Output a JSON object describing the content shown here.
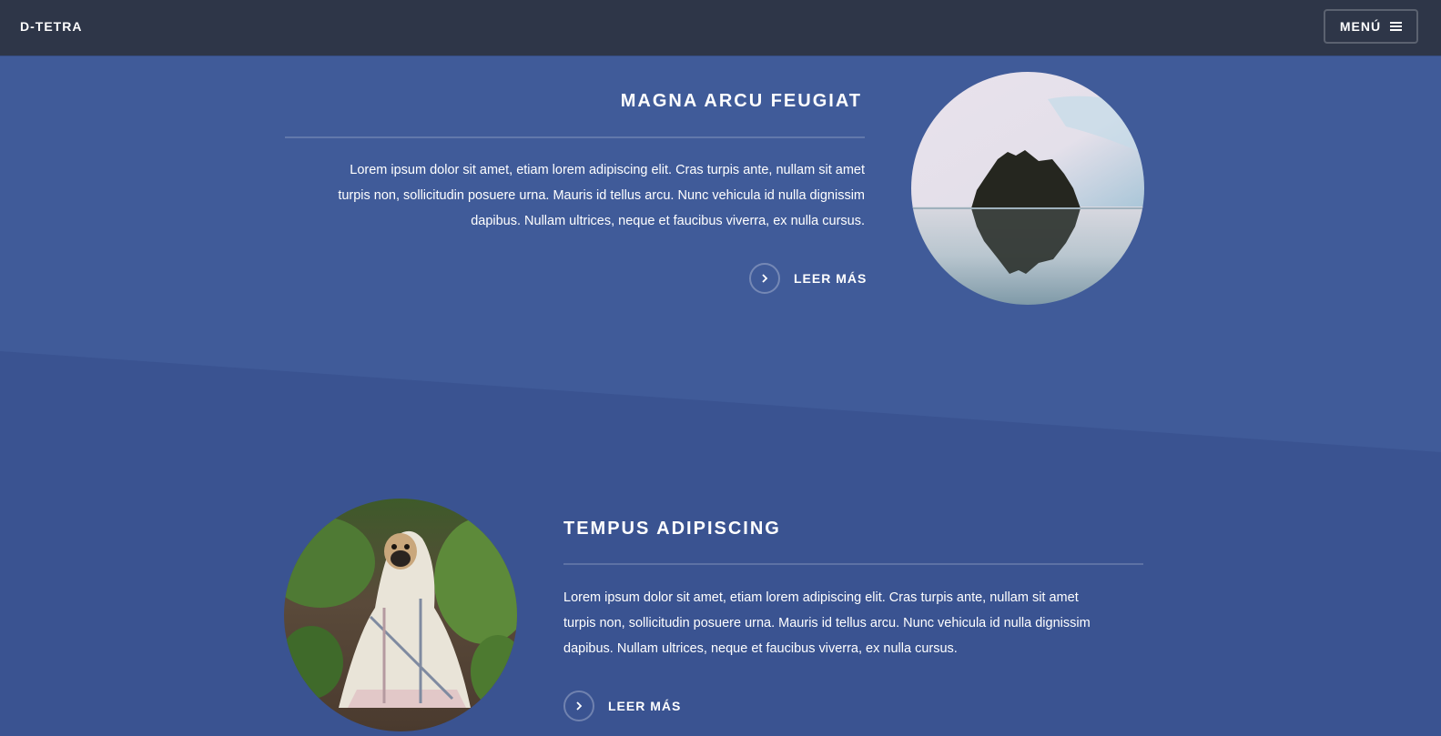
{
  "header": {
    "logo": "D-TETRA",
    "menu_label": "MENÚ",
    "menu_icon": "hamburger-icon"
  },
  "features": [
    {
      "title": "MAGNA ARCU FEUGIAT",
      "text_lines": [
        "Lorem ipsum dolor sit amet, etiam lorem adipiscing elit. Cras turpis ante, nullam sit amet",
        "turpis non, sollicitudin posuere urna. Mauris id tellus arcu. Nunc vehicula id nulla dignissim",
        "dapibus. Nullam ultrices, neque et faucibus viverra, ex nulla cursus."
      ],
      "link_label": "LEER MÁS",
      "link_icon": "chevron-right-icon",
      "image": "rock-island-photo"
    },
    {
      "title": "TEMPUS ADIPISCING",
      "text_lines": [
        "Lorem ipsum dolor sit amet, etiam lorem adipiscing elit. Cras turpis ante, nullam sit amet",
        "turpis non, sollicitudin posuere urna. Mauris id tellus arcu. Nunc vehicula id nulla dignissim",
        "dapibus. Nullam ultrices, neque et faucibus viverra, ex nulla cursus."
      ],
      "link_label": "LEER MÁS",
      "link_icon": "chevron-right-icon",
      "image": "pug-blanket-photo"
    }
  ],
  "colors": {
    "header_bg": "#2e3648",
    "section_top_bg": "#405b99",
    "section_bottom_bg": "#3a5391",
    "text": "#ffffff"
  }
}
